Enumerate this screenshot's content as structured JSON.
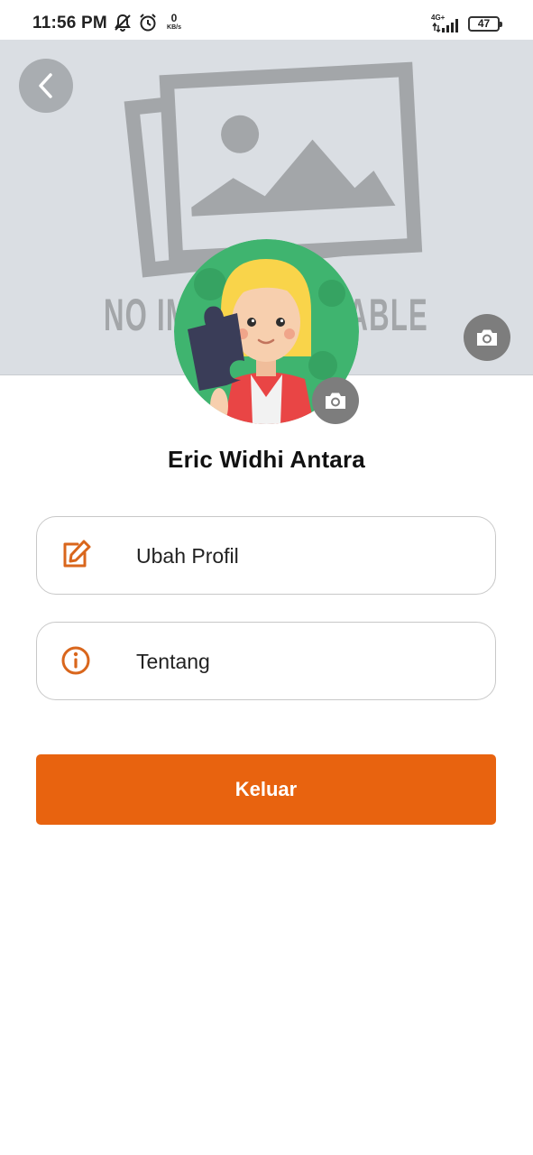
{
  "status_bar": {
    "time": "11:56 PM",
    "net_speed": "0",
    "net_unit": "KB/s",
    "network": "4G+",
    "battery": "47",
    "icons": [
      "notification-mute-icon",
      "alarm-icon",
      "signal-icon",
      "battery-icon"
    ]
  },
  "cover": {
    "placeholder_text": "NO IMAGE AVAILABLE",
    "back_icon": "chevron-left-icon",
    "camera_icon": "camera-icon"
  },
  "profile": {
    "name": "Eric Widhi Antara",
    "avatar_icon": "avatar-illustration"
  },
  "menu": [
    {
      "label": "Ubah Profil",
      "icon": "edit-icon"
    },
    {
      "label": "Tentang",
      "icon": "info-icon"
    }
  ],
  "logout_label": "Keluar",
  "colors": {
    "accent": "#e8630f",
    "icon_accent": "#d9661c",
    "cover_bg": "#dadee3",
    "camera_bg": "#7d7d7d"
  }
}
